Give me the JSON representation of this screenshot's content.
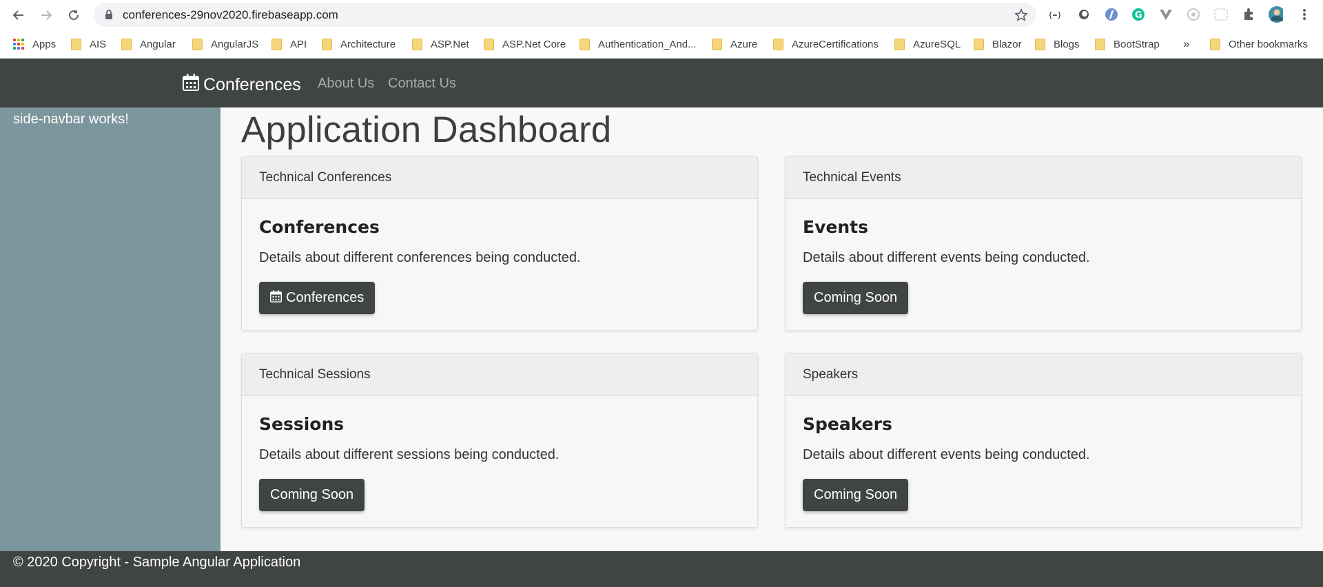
{
  "browser": {
    "url": "conferences-29nov2020.firebaseapp.com",
    "bookmarks": [
      "Apps",
      "AIS",
      "Angular",
      "AngularJS",
      "API",
      "Architecture",
      "ASP.Net",
      "ASP.Net Core",
      "Authentication_And...",
      "Azure",
      "AzureCertifications",
      "AzureSQL",
      "Blazor",
      "Blogs",
      "BootStrap"
    ],
    "overflow": "»",
    "other_bookmarks": "Other bookmarks"
  },
  "navbar": {
    "brand": "Conferences",
    "links": [
      "About Us",
      "Contact Us"
    ]
  },
  "sidebar": {
    "text": "side-navbar works!"
  },
  "main": {
    "title": "Application Dashboard",
    "cards": [
      {
        "header": "Technical Conferences",
        "title": "Conferences",
        "text": "Details about different conferences being conducted.",
        "button": "Conferences"
      },
      {
        "header": "Technical Events",
        "title": "Events",
        "text": "Details about different events being conducted.",
        "button": "Coming Soon"
      },
      {
        "header": "Technical Sessions",
        "title": "Sessions",
        "text": "Details about different sessions being conducted.",
        "button": "Coming Soon"
      },
      {
        "header": "Speakers",
        "title": "Speakers",
        "text": "Details about different events being conducted.",
        "button": "Coming Soon"
      }
    ]
  },
  "footer": {
    "text": "© 2020 Copyright - Sample Angular Application"
  },
  "colors": {
    "navbar_bg": "#414542",
    "sidebar_bg": "#7b969c",
    "button_bg": "#414542"
  }
}
